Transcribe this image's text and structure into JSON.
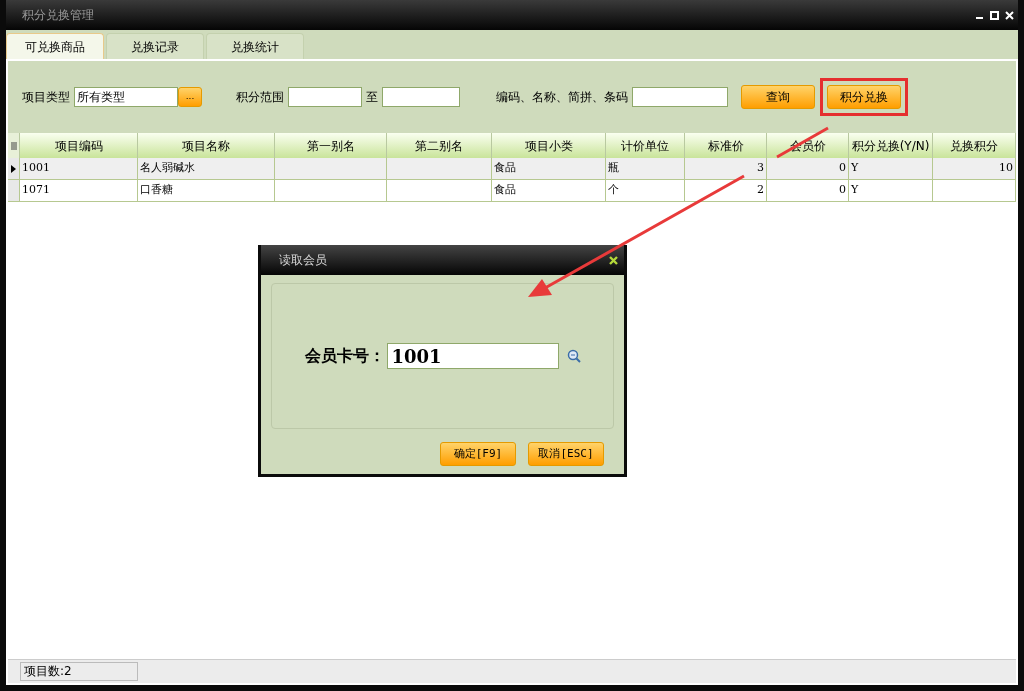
{
  "window": {
    "title": "积分兑换管理"
  },
  "tabs": [
    {
      "label": "可兑换商品",
      "selected": true
    },
    {
      "label": "兑换记录",
      "selected": false
    },
    {
      "label": "兑换统计",
      "selected": false
    }
  ],
  "filter": {
    "type_label": "项目类型",
    "type_value": "所有类型",
    "type_button": "...",
    "range_label": "积分范围",
    "range_separator": "至",
    "search_label": "编码、名称、简拼、条码",
    "buttons": [
      {
        "label": "查询",
        "highlighted": false
      },
      {
        "label": "积分兑换",
        "highlighted": true
      }
    ]
  },
  "table": {
    "columns": [
      "项目编码",
      "项目名称",
      "第一别名",
      "第二别名",
      "项目小类",
      "计价单位",
      "标准价",
      "会员价",
      "积分兑换(Y/N)",
      "兑换积分"
    ],
    "rows": [
      {
        "selected": true,
        "cells": [
          "1001",
          "名人弱碱水",
          "",
          "",
          "食品",
          "瓶",
          "3",
          "0",
          "Y",
          "10"
        ]
      },
      {
        "selected": false,
        "cells": [
          "1071",
          "口香糖",
          "",
          "",
          "食品",
          "个",
          "2",
          "0",
          "Y",
          ""
        ]
      }
    ]
  },
  "dialog": {
    "title": "读取会员",
    "field_label": "会员卡号：",
    "field_value": "1001",
    "buttons": [
      "确定[F9]",
      "取消[ESC]"
    ]
  },
  "status_bar": {
    "text": "项目数:2"
  }
}
